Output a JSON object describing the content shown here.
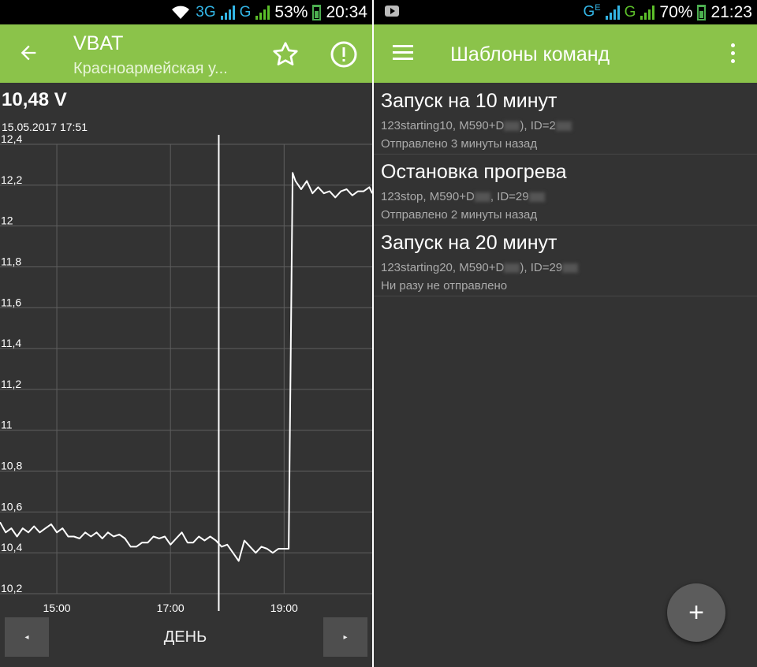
{
  "left": {
    "status": {
      "network": "3G",
      "network2": "G",
      "battery": "53%",
      "time": "20:34"
    },
    "toolbar": {
      "title": "VBAT",
      "subtitle": "Красноармейская у..."
    },
    "value": "10,48 V",
    "timestamp": "15.05.2017 17:51",
    "period": "ДЕНЬ",
    "nav_prev": "◂",
    "nav_next": "▸"
  },
  "right": {
    "status": {
      "network": "G",
      "network_sup": "E",
      "network2": "G",
      "battery": "70%",
      "time": "21:23"
    },
    "toolbar": {
      "title": "Шаблоны команд"
    },
    "commands": [
      {
        "name": "Запуск на 10 минут",
        "detail_a": "123starting10, M590+D",
        "detail_b": "), ID=2",
        "sent": "Отправлено 3 минуты назад"
      },
      {
        "name": "Остановка прогрева",
        "detail_a": "123stop, M590+D",
        "detail_b": ", ID=29",
        "sent": "Отправлено 2 минуты назад"
      },
      {
        "name": "Запуск на 20 минут",
        "detail_a": "123starting20, M590+D",
        "detail_b": "), ID=29",
        "sent": "Ни разу не отправлено"
      }
    ],
    "fab": "+"
  },
  "chart_data": {
    "type": "line",
    "ylim": [
      10.2,
      12.4
    ],
    "y_ticks": [
      "12,4",
      "12,2",
      "12",
      "11,8",
      "11,6",
      "11,4",
      "11,2",
      "11",
      "10,8",
      "10,6",
      "10,4",
      "10,2"
    ],
    "x_ticks": [
      "15:00",
      "17:00",
      "19:00"
    ],
    "x_tick_hours": [
      15,
      17,
      19
    ],
    "xlim_hours": [
      14.0,
      20.55
    ],
    "cursor_hour": 17.85,
    "series": [
      {
        "x": [
          14.0,
          14.1,
          14.2,
          14.3,
          14.4,
          14.5,
          14.6,
          14.7,
          14.8,
          14.9,
          15.0,
          15.1,
          15.2,
          15.3,
          15.4,
          15.5,
          15.6,
          15.7,
          15.8,
          15.9,
          16.0,
          16.1,
          16.2,
          16.3,
          16.4,
          16.5,
          16.6,
          16.7,
          16.8,
          16.9,
          17.0,
          17.1,
          17.2,
          17.3,
          17.4,
          17.5,
          17.6,
          17.7,
          17.8,
          17.9,
          18.0,
          18.1,
          18.2,
          18.3,
          18.4,
          18.5,
          18.6,
          18.7,
          18.8,
          18.9,
          19.0,
          19.08,
          19.15,
          19.2,
          19.3,
          19.4,
          19.5,
          19.6,
          19.7,
          19.8,
          19.9,
          20.0,
          20.1,
          20.2,
          20.3,
          20.4,
          20.5,
          20.55
        ],
        "y": [
          10.55,
          10.5,
          10.52,
          10.48,
          10.52,
          10.5,
          10.53,
          10.5,
          10.52,
          10.54,
          10.5,
          10.52,
          10.48,
          10.48,
          10.47,
          10.5,
          10.48,
          10.5,
          10.47,
          10.5,
          10.48,
          10.49,
          10.47,
          10.43,
          10.43,
          10.45,
          10.45,
          10.48,
          10.47,
          10.48,
          10.44,
          10.47,
          10.5,
          10.45,
          10.45,
          10.48,
          10.46,
          10.48,
          10.46,
          10.43,
          10.44,
          10.4,
          10.36,
          10.46,
          10.43,
          10.4,
          10.43,
          10.42,
          10.4,
          10.42,
          10.42,
          10.42,
          12.26,
          12.22,
          12.18,
          12.22,
          12.16,
          12.19,
          12.16,
          12.17,
          12.14,
          12.17,
          12.18,
          12.15,
          12.17,
          12.17,
          12.19,
          12.16
        ]
      }
    ]
  },
  "colors": {
    "toolbar": "#8bc34a",
    "background": "#333333",
    "line": "#ffffff"
  }
}
